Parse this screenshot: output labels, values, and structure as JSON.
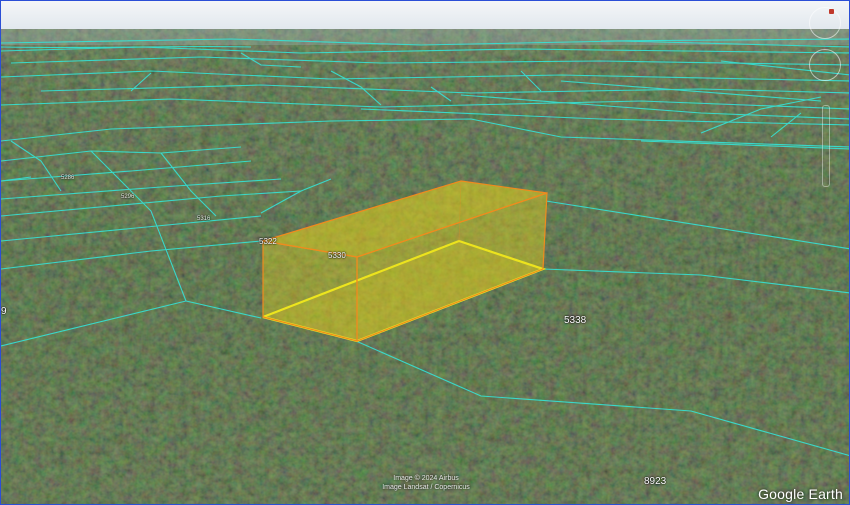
{
  "map": {
    "parcel_labels": [
      {
        "id": "5322",
        "text": "5322"
      },
      {
        "id": "5330",
        "text": "5330"
      },
      {
        "id": "5338",
        "text": "5338"
      },
      {
        "id": "5316",
        "text": "5316"
      },
      {
        "id": "5296",
        "text": "5296"
      },
      {
        "id": "5286",
        "text": "5286"
      },
      {
        "id": "8923",
        "text": "8923"
      },
      {
        "id": "edge",
        "text": "9"
      }
    ],
    "attribution": {
      "line1": "Image © 2024 Airbus",
      "line2": "Image Landsat / Copernicus"
    },
    "logo": "Google Earth",
    "colors": {
      "sky": "#e9eef3",
      "parcel_lines": "#35e3d6",
      "selection_fill": "#e8d21a",
      "selection_edge": "#f08a1e",
      "ground_outline": "#f0f020"
    },
    "controls": [
      "look-control",
      "move-control",
      "zoom-slider"
    ]
  }
}
